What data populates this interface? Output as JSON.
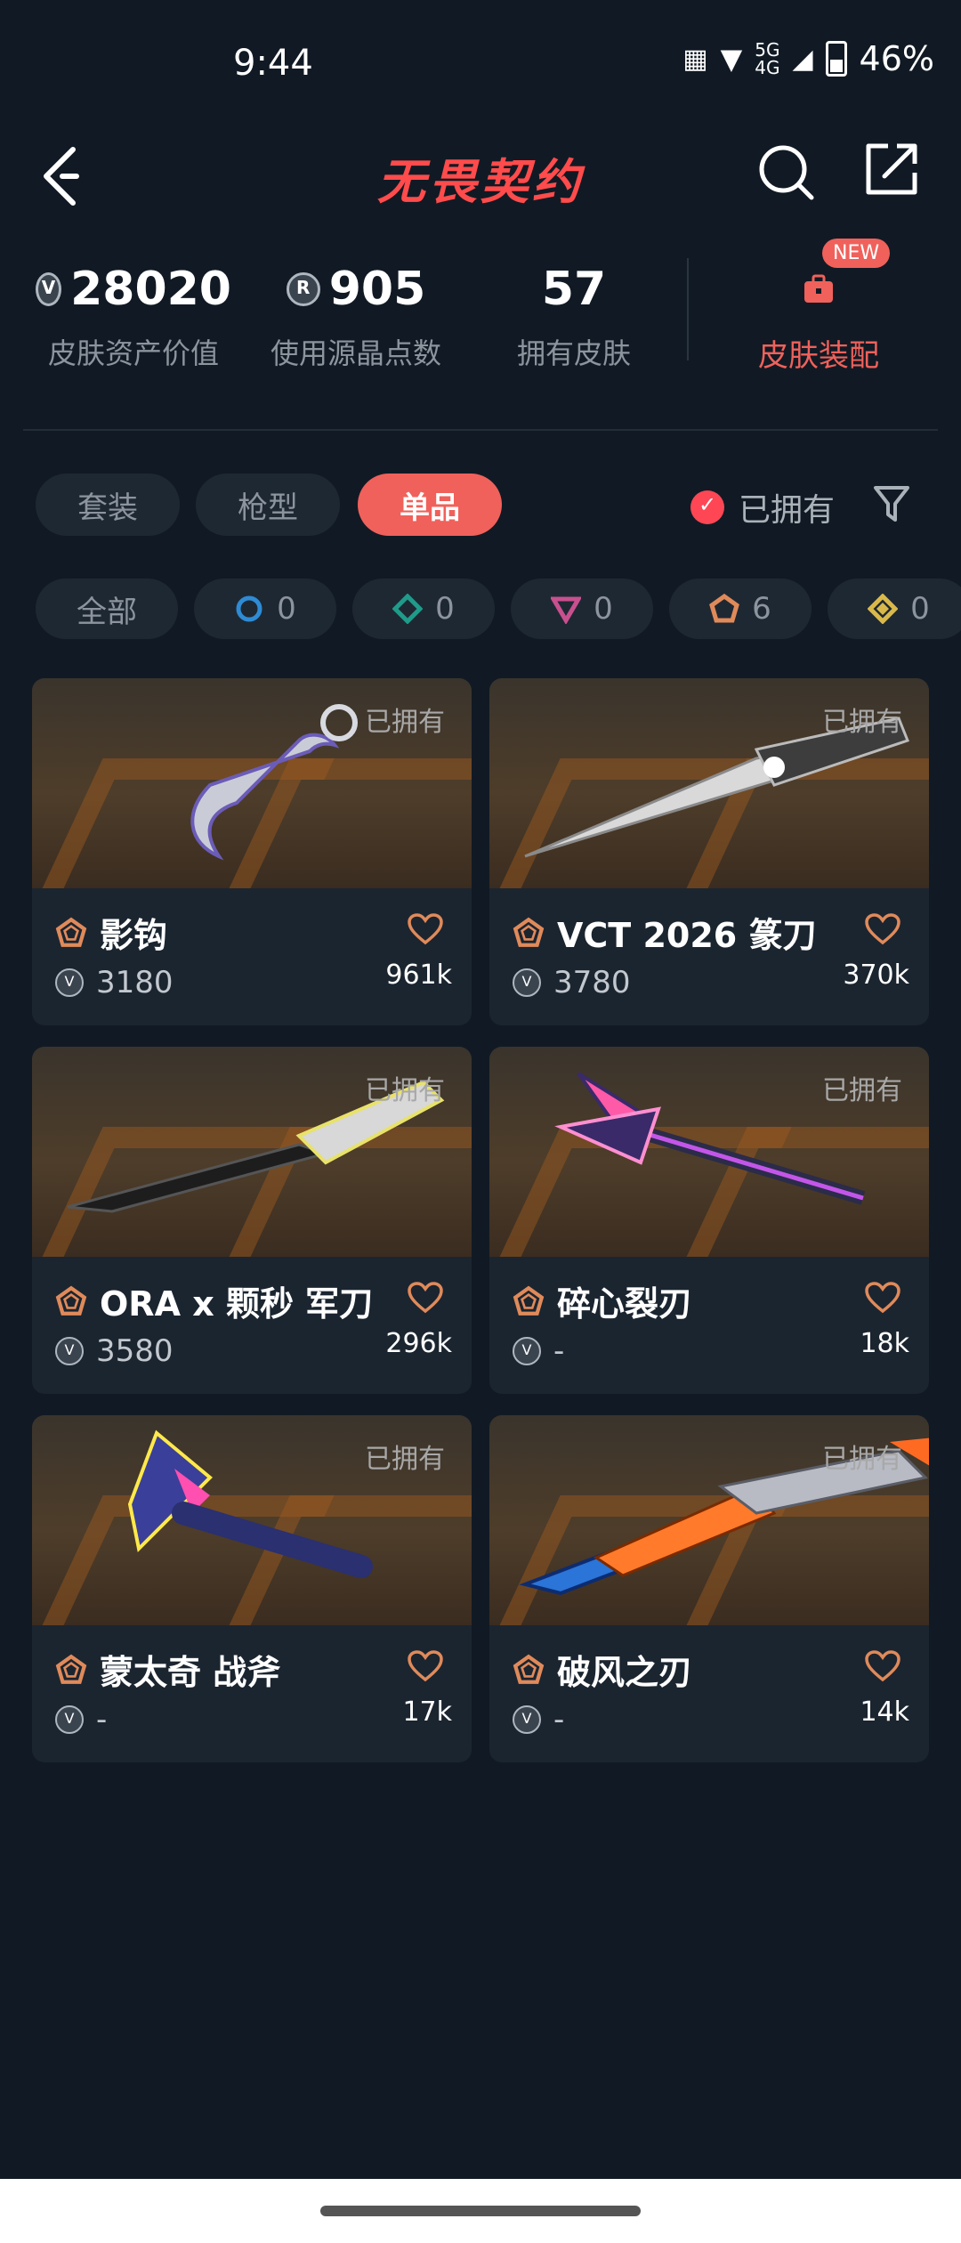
{
  "status_bar": {
    "time": "9:44",
    "network": "5G",
    "network2": "4G",
    "battery": "46%"
  },
  "header": {
    "title": "无畏契约"
  },
  "stats": [
    {
      "value": "28020",
      "label": "皮肤资产价值",
      "icon": "vp-coin-icon"
    },
    {
      "value": "905",
      "label": "使用源晶点数",
      "icon": "radianite-icon"
    },
    {
      "value": "57",
      "label": "拥有皮肤"
    }
  ],
  "equip": {
    "badge": "NEW",
    "label": "皮肤装配"
  },
  "tabs": [
    {
      "label": "套装",
      "active": false
    },
    {
      "label": "枪型",
      "active": false
    },
    {
      "label": "单品",
      "active": true
    }
  ],
  "owned_filter": {
    "label": "已拥有",
    "checked": true
  },
  "tiers": [
    {
      "label": "全部"
    },
    {
      "count": "0",
      "color": "#2e8bd4"
    },
    {
      "count": "0",
      "color": "#1f9b8a"
    },
    {
      "count": "0",
      "color": "#c8508f"
    },
    {
      "count": "6",
      "color": "#e08a5a"
    },
    {
      "count": "0",
      "color": "#d9b94a"
    }
  ],
  "cards": [
    {
      "name": "影钩",
      "price": "3180",
      "likes": "961k",
      "owned": "已拥有"
    },
    {
      "name": "VCT 2026 篆刀",
      "price": "3780",
      "likes": "370k",
      "owned": "已拥有"
    },
    {
      "name": "ORA x 颗秒 军刀",
      "price": "3580",
      "likes": "296k",
      "owned": "已拥有"
    },
    {
      "name": "碎心裂刃",
      "price": "-",
      "likes": "18k",
      "owned": "已拥有"
    },
    {
      "name": "蒙太奇 战斧",
      "price": "-",
      "likes": "17k",
      "owned": "已拥有"
    },
    {
      "name": "破风之刃",
      "price": "-",
      "likes": "14k",
      "owned": "已拥有"
    }
  ],
  "colors": {
    "accent": "#f0615b",
    "background": "#111a24",
    "card": "#1b2530",
    "exclusive_tier": "#e08a5a"
  }
}
